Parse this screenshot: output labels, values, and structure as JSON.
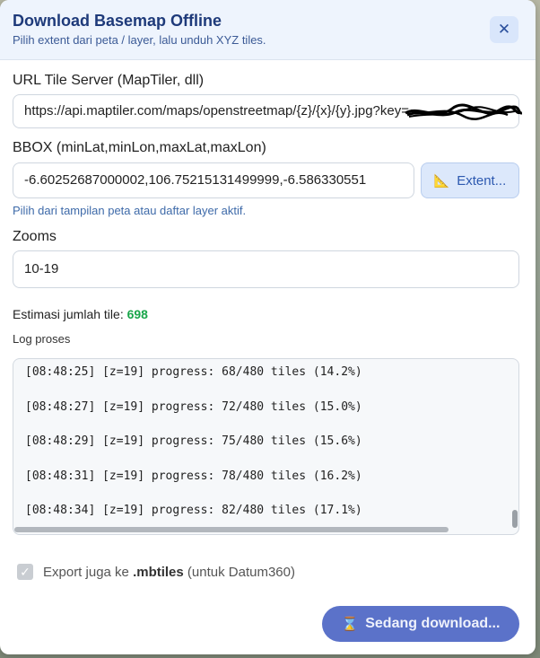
{
  "dialog": {
    "title": "Download Basemap Offline",
    "subtitle": "Pilih extent dari peta / layer, lalu unduh XYZ tiles.",
    "close_icon": "close-icon"
  },
  "url": {
    "label": "URL Tile Server (MapTiler, dll)",
    "value": "https://api.maptiler.com/maps/openstreetmap/{z}/{x}/{y}.jpg?key="
  },
  "bbox": {
    "label": "BBOX (minLat,minLon,maxLat,maxLon)",
    "value": "-6.60252687000002,106.75215131499999,-6.586330551",
    "extent_button": "Extent...",
    "extent_icon": "ruler-triangle-icon",
    "hint": "Pilih dari tampilan peta atau daftar layer aktif."
  },
  "zooms": {
    "label": "Zooms",
    "value": "10-19"
  },
  "estimate": {
    "label": "Estimasi jumlah tile:",
    "count": "698"
  },
  "log": {
    "label": "Log proses",
    "lines": [
      "[08:48:25] [z=19] progress: 68/480 tiles (14.2%)",
      "[08:48:27] [z=19] progress: 72/480 tiles (15.0%)",
      "[08:48:29] [z=19] progress: 75/480 tiles (15.6%)",
      "[08:48:31] [z=19] progress: 78/480 tiles (16.2%)",
      "[08:48:34] [z=19] progress: 82/480 tiles (17.1%)"
    ]
  },
  "export": {
    "checked": true,
    "prefix": "Export juga ke",
    "format": ".mbtiles",
    "suffix": "(untuk Datum360)"
  },
  "download_button": {
    "label": "Sedang download...",
    "icon": "hourglass-icon"
  },
  "colors": {
    "accent": "#5b72c9",
    "title": "#1e3a7a",
    "count": "#19a64a"
  }
}
